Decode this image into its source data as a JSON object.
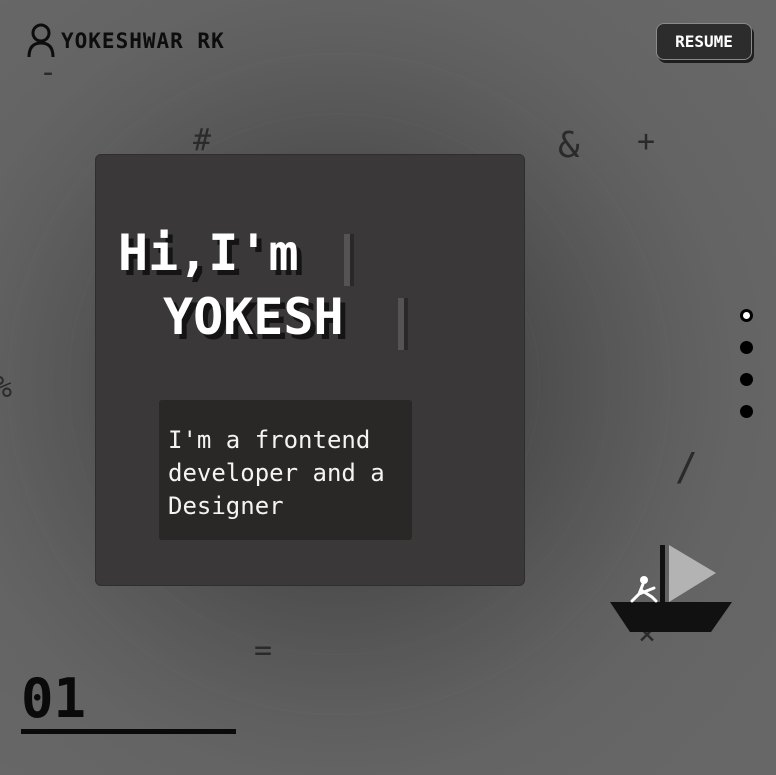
{
  "header": {
    "icon": "user-icon",
    "brand_name": "YOKESHWAR RK",
    "resume_label": "RESUME"
  },
  "hero": {
    "greeting": "Hi,I'm",
    "name": "YOKESH",
    "intro_lines": [
      "I'm a frontend",
      "developer and a",
      "Designer"
    ]
  },
  "decor_symbols": [
    "-",
    "#",
    "&",
    "+",
    "%",
    "/",
    "=",
    "×"
  ],
  "pagination": {
    "dots": [
      {
        "active": true
      },
      {
        "active": false
      },
      {
        "active": false
      },
      {
        "active": false
      }
    ],
    "current_page": "01"
  },
  "illustration": {
    "icon": "sailboat-icon"
  },
  "colors": {
    "background": "#5f5f5f",
    "card": "#3a3838",
    "text_box": "#292827",
    "button": "#2d2c2c",
    "accent_dark": "#0a0a0a",
    "text_light": "#ffffff"
  }
}
